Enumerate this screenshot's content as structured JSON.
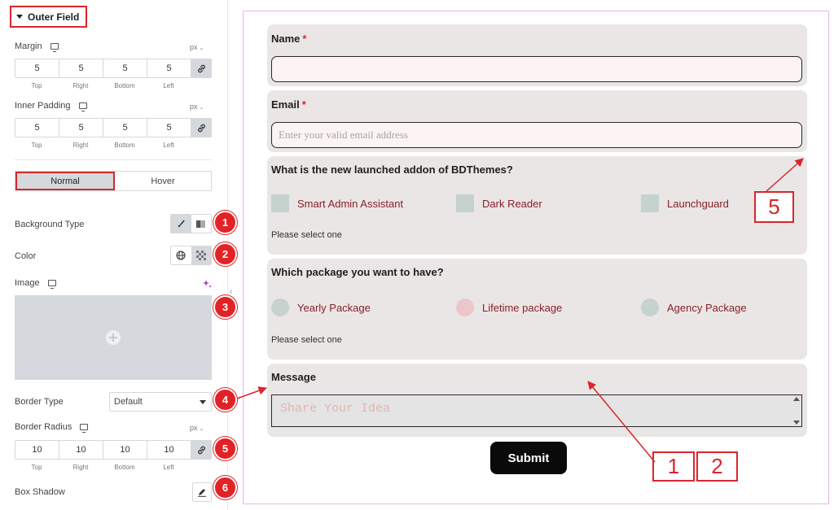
{
  "panel": {
    "section_title": "Outer Field",
    "margin": {
      "label": "Margin",
      "unit": "px",
      "values": [
        "5",
        "5",
        "5",
        "5"
      ]
    },
    "inner_padding": {
      "label": "Inner Padding",
      "unit": "px",
      "values": [
        "5",
        "5",
        "5",
        "5"
      ]
    },
    "dim_captions": [
      "Top",
      "Right",
      "Bottom",
      "Left"
    ],
    "tabs": [
      "Normal",
      "Hover"
    ],
    "background_type": "Background Type",
    "color": "Color",
    "image": "Image",
    "border_type": {
      "label": "Border Type",
      "value": "Default"
    },
    "border_radius": {
      "label": "Border Radius",
      "unit": "px",
      "values": [
        "10",
        "10",
        "10",
        "10"
      ]
    },
    "box_shadow": "Box Shadow",
    "badges": [
      "1",
      "2",
      "3",
      "4",
      "5",
      "6"
    ]
  },
  "form": {
    "name_label": "Name",
    "required_mark": "*",
    "email_label": "Email",
    "email_placeholder": "Enter your valid email address",
    "checkbox_question": "What is the new launched addon of BDThemes?",
    "checkbox_options": [
      "Smart Admin Assistant",
      "Dark Reader",
      "Launchguard"
    ],
    "checkbox_hint": "Please select one",
    "radio_question": "Which package you want to have?",
    "radio_options": [
      "Yearly Package",
      "Lifetime package",
      "Agency Package"
    ],
    "radio_hint": "Please select one",
    "message_label": "Message",
    "message_placeholder": "Share Your Idea",
    "submit_label": "Submit"
  },
  "callouts": [
    "5",
    "1",
    "2"
  ],
  "colors": {
    "accent_red": "#d9262c",
    "field_bg": "#e9e6e5",
    "input_bg": "#fcf3f3",
    "option_text": "#8a1f2b"
  }
}
